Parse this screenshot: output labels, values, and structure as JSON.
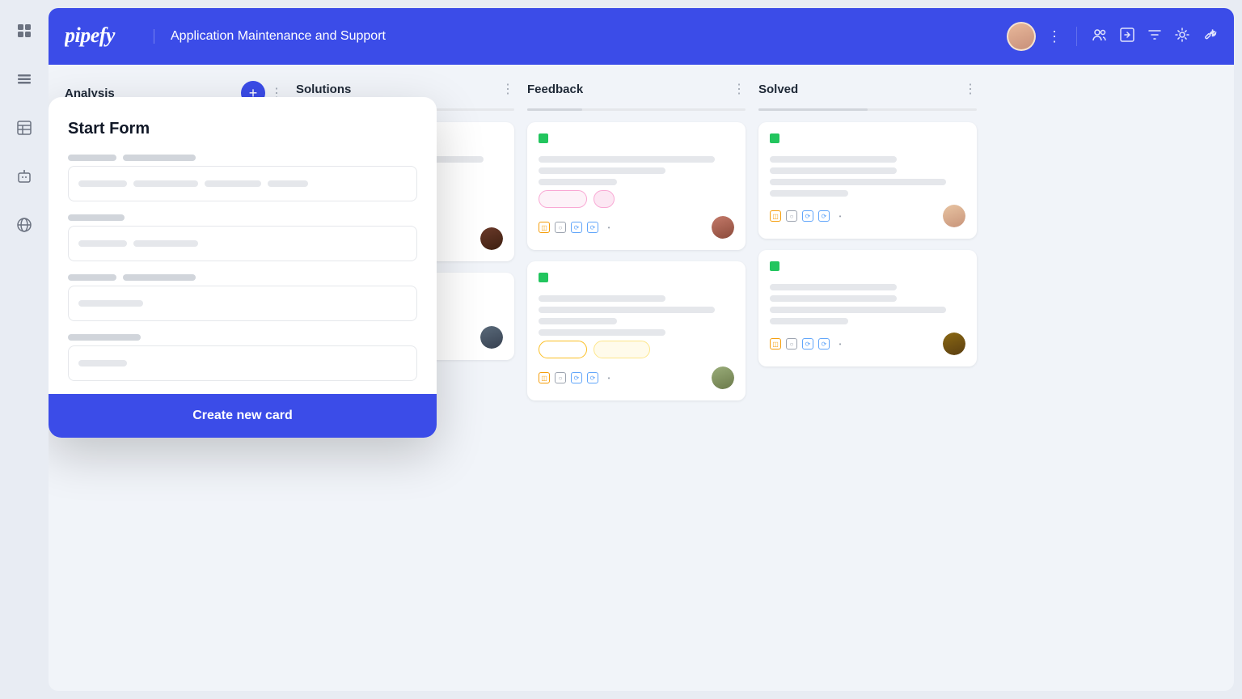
{
  "app": {
    "name": "Pipefy",
    "title": "Application Maintenance and Support"
  },
  "header": {
    "logo": "pipefy",
    "title": "Application Maintenance and Support",
    "icons": [
      "users-icon",
      "login-icon",
      "filter-icon",
      "settings-icon",
      "wrench-icon"
    ],
    "more_icon": "⋮"
  },
  "sidebar": {
    "icons": [
      {
        "name": "grid-icon",
        "symbol": "⊞"
      },
      {
        "name": "list-icon",
        "symbol": "☰"
      },
      {
        "name": "table-icon",
        "symbol": "▦"
      },
      {
        "name": "bot-icon",
        "symbol": "◉"
      },
      {
        "name": "globe-icon",
        "symbol": "⊕"
      }
    ]
  },
  "columns": [
    {
      "id": "analysis",
      "title": "Analysis",
      "show_add": true
    },
    {
      "id": "solutions",
      "title": "Solutions",
      "show_add": false
    },
    {
      "id": "feedback",
      "title": "Feedback",
      "show_add": false
    },
    {
      "id": "solved",
      "title": "Solved",
      "show_add": false
    }
  ],
  "modal": {
    "title": "Start Form",
    "field1_label1": "",
    "field1_label2": "",
    "field2_label": "",
    "field3_label1": "",
    "field3_label2": "",
    "field4_label": "",
    "create_button": "Create new card"
  }
}
